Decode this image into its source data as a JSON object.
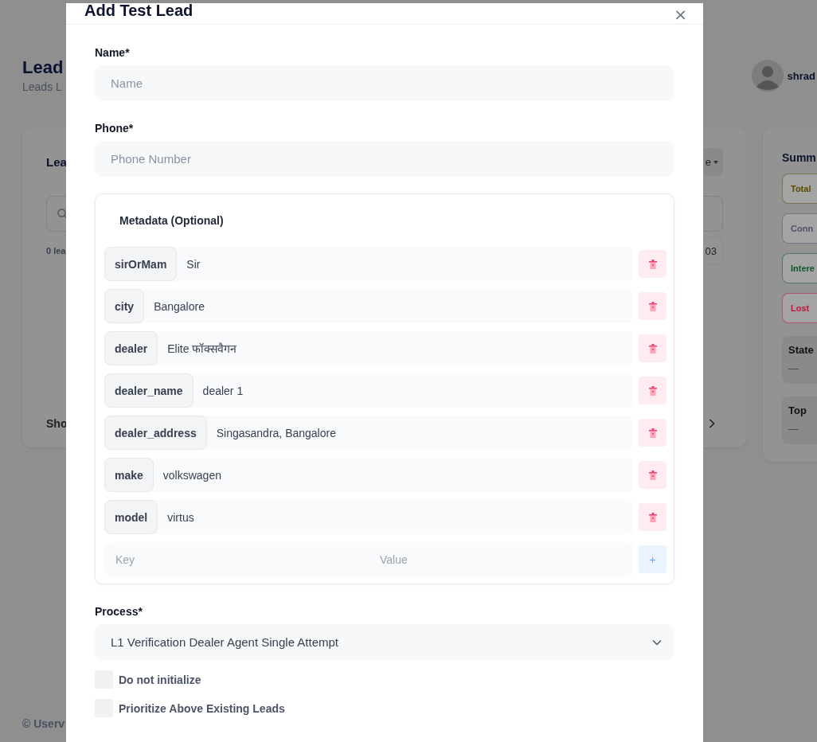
{
  "background": {
    "page_title": "Lead",
    "page_subtitle": "Leads L",
    "user_name": "shrad",
    "leads_card": {
      "title": "Lea",
      "filter_label": "e",
      "count": "0 lea",
      "page_chip": "03",
      "footer_label": "Sho"
    },
    "summary_card": {
      "title": "Summ",
      "stats": [
        {
          "label": "Total",
          "color": "#5c4a00"
        },
        {
          "label": "Conn",
          "color": "#4b5270"
        },
        {
          "label": "Intere",
          "color": "#0a5a27"
        },
        {
          "label": "Lost",
          "color": "#be123c"
        }
      ],
      "sections": [
        {
          "title": "State",
          "value": "—"
        },
        {
          "title": "Top",
          "value": "—"
        }
      ]
    },
    "footer": "© Userv"
  },
  "dialog": {
    "title": "Add Test Lead",
    "close": "×",
    "fields": [
      {
        "label": "Name*",
        "placeholder": "Name"
      },
      {
        "label": "Phone*",
        "placeholder": "Phone Number"
      }
    ],
    "metadata": {
      "title": "Metadata (Optional)",
      "entries": [
        {
          "key": "sirOrMam",
          "value": "Sir"
        },
        {
          "key": "city",
          "value": "Bangalore"
        },
        {
          "key": "dealer",
          "value": "Elite फॉक्सवैगन"
        },
        {
          "key": "dealer_name",
          "value": "dealer 1"
        },
        {
          "key": "dealer_address",
          "value": "Singasandra, Bangalore"
        },
        {
          "key": "make",
          "value": "volkswagen"
        },
        {
          "key": "model",
          "value": "virtus"
        }
      ],
      "new_entry": {
        "key_placeholder": "Key",
        "value_placeholder": "Value",
        "add_label": "+"
      }
    },
    "process": {
      "label": "Process*",
      "value": "L1 Verification Dealer Agent Single Attempt"
    },
    "options": [
      {
        "label": "Do not initialize",
        "checked": false
      },
      {
        "label": "Prioritize Above Existing Leads",
        "checked": false
      }
    ]
  }
}
